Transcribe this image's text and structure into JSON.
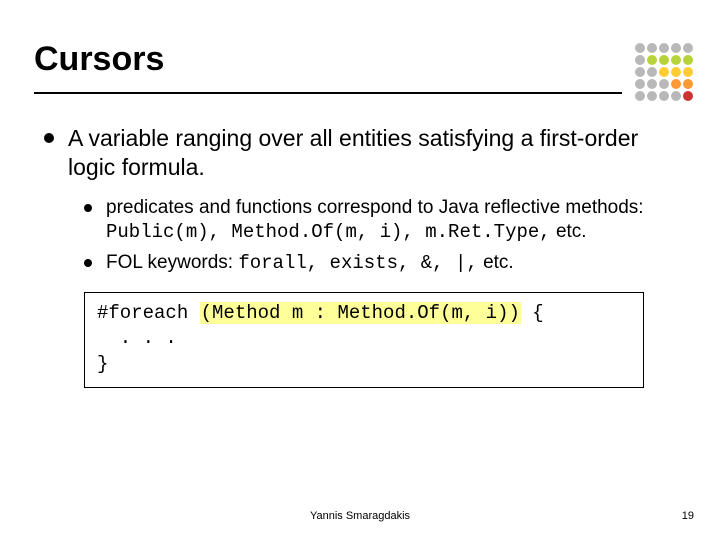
{
  "slide": {
    "title": "Cursors",
    "bullets": [
      {
        "text": "A variable ranging over all entities satisfying a first-order logic formula.",
        "sub": [
          {
            "pre": "predicates and functions correspond to Java reflective methods: ",
            "code": "Public(m), Method.Of(m, i), m.Ret.Type,",
            "post": " etc."
          },
          {
            "pre": "FOL keywords: ",
            "code": "forall, exists, &, |,",
            "post": " etc."
          }
        ]
      }
    ],
    "code_box": {
      "line1_pre": "#foreach ",
      "line1_hl": "(Method m : Method.Of(m, i))",
      "line1_post": " {",
      "line2": "  . . .",
      "line3": "}"
    },
    "footer": {
      "author": "Yannis Smaragdakis",
      "page": "19"
    }
  }
}
